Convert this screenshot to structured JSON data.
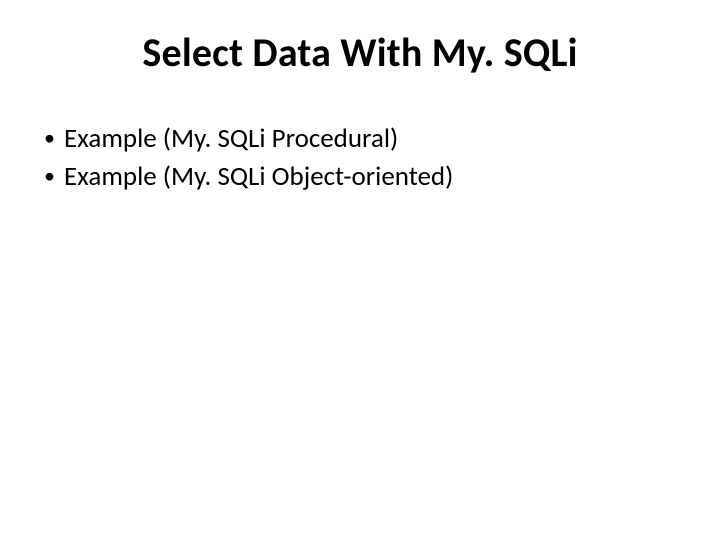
{
  "slide": {
    "title": "Select Data With My. SQLi",
    "bullets": [
      {
        "text": "Example (My. SQLi Procedural)"
      },
      {
        "text": "Example (My. SQLi Object-oriented)"
      }
    ]
  }
}
